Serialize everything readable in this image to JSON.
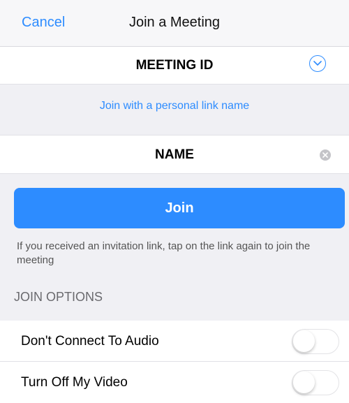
{
  "navbar": {
    "cancel_label": "Cancel",
    "title": "Join a Meeting"
  },
  "meeting_id": {
    "placeholder": "MEETING ID",
    "dropdown_icon": "chevron-down-circle-icon"
  },
  "personal_link": {
    "label": "Join with a personal link name"
  },
  "name": {
    "placeholder": "NAME",
    "clear_icon": "clear-icon"
  },
  "join": {
    "label": "Join"
  },
  "hint": {
    "text": "If you received an invitation link, tap on the link again to join the meeting"
  },
  "join_options": {
    "header": "JOIN OPTIONS",
    "items": [
      {
        "label": "Don't Connect To Audio",
        "enabled": false
      },
      {
        "label": "Turn Off My Video",
        "enabled": false
      }
    ]
  },
  "colors": {
    "accent": "#2d8cff",
    "background": "#f0f0f4"
  }
}
